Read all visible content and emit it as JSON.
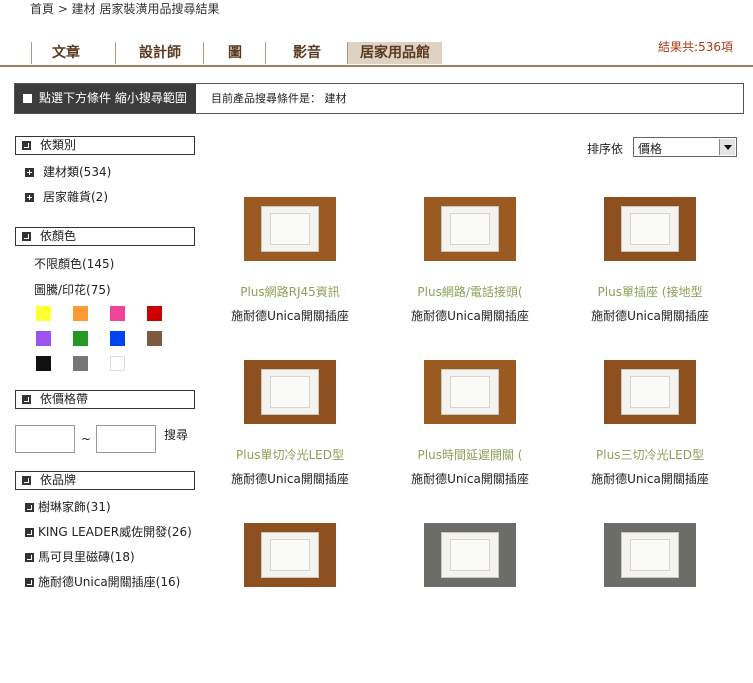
{
  "breadcrumb": "首頁 > 建材 居家裝潢用品搜尋結果",
  "tabs": [
    "文章",
    "設計師",
    "圖",
    "影音",
    "居家用品館"
  ],
  "result_count": "結果共:536項",
  "filter": {
    "title": "點選下方條件 縮小搜尋範圍",
    "current": "目前產品搜尋條件是： 建材"
  },
  "category": {
    "title": "依類別",
    "items": [
      "建材類(534)",
      "居家雜貨(2)"
    ]
  },
  "color": {
    "title": "依顏色",
    "items": [
      "不限顏色(145)",
      "圖騰/印花(75)"
    ],
    "swatches": [
      "#ffff33",
      "#ff9933",
      "#ee4499",
      "#cc0000",
      "#9955ee",
      "#229922",
      "#0044ee",
      "#7a5a40",
      "#111111",
      "#777777",
      "#ffffff"
    ]
  },
  "price": {
    "title": "依價格帶",
    "tilde": "~",
    "search": "搜尋"
  },
  "brand": {
    "title": "依品牌",
    "items": [
      "樹琳家飾(31)",
      "KING LEADER威佐開發(26)",
      "馬可貝里磁磚(18)",
      "施耐德Unica開關插座(16)"
    ]
  },
  "sort": {
    "label": "排序依",
    "value": "價格"
  },
  "products": [
    {
      "name": "Plus網路RJ45資訊",
      "brand": "施耐德Unica開關插座",
      "bg": "#9a5a22"
    },
    {
      "name": "Plus網路/電話接頭(",
      "brand": "施耐德Unica開關插座",
      "bg": "#9a5a22"
    },
    {
      "name": "Plus單插座 (接地型",
      "brand": "施耐德Unica開關插座",
      "bg": "#8f5020"
    },
    {
      "name": "Plus單切冷光LED型",
      "brand": "施耐德Unica開關插座",
      "bg": "#8f5020"
    },
    {
      "name": "Plus時間延遲開關 (",
      "brand": "施耐德Unica開關插座",
      "bg": "#9a5a22"
    },
    {
      "name": "Plus三切冷光LED型",
      "brand": "施耐德Unica開關插座",
      "bg": "#8f5020"
    },
    {
      "name": "",
      "brand": "",
      "bg": "#8f5020"
    },
    {
      "name": "",
      "brand": "",
      "bg": "#6c6c68"
    },
    {
      "name": "",
      "brand": "",
      "bg": "#6c6c68"
    }
  ]
}
